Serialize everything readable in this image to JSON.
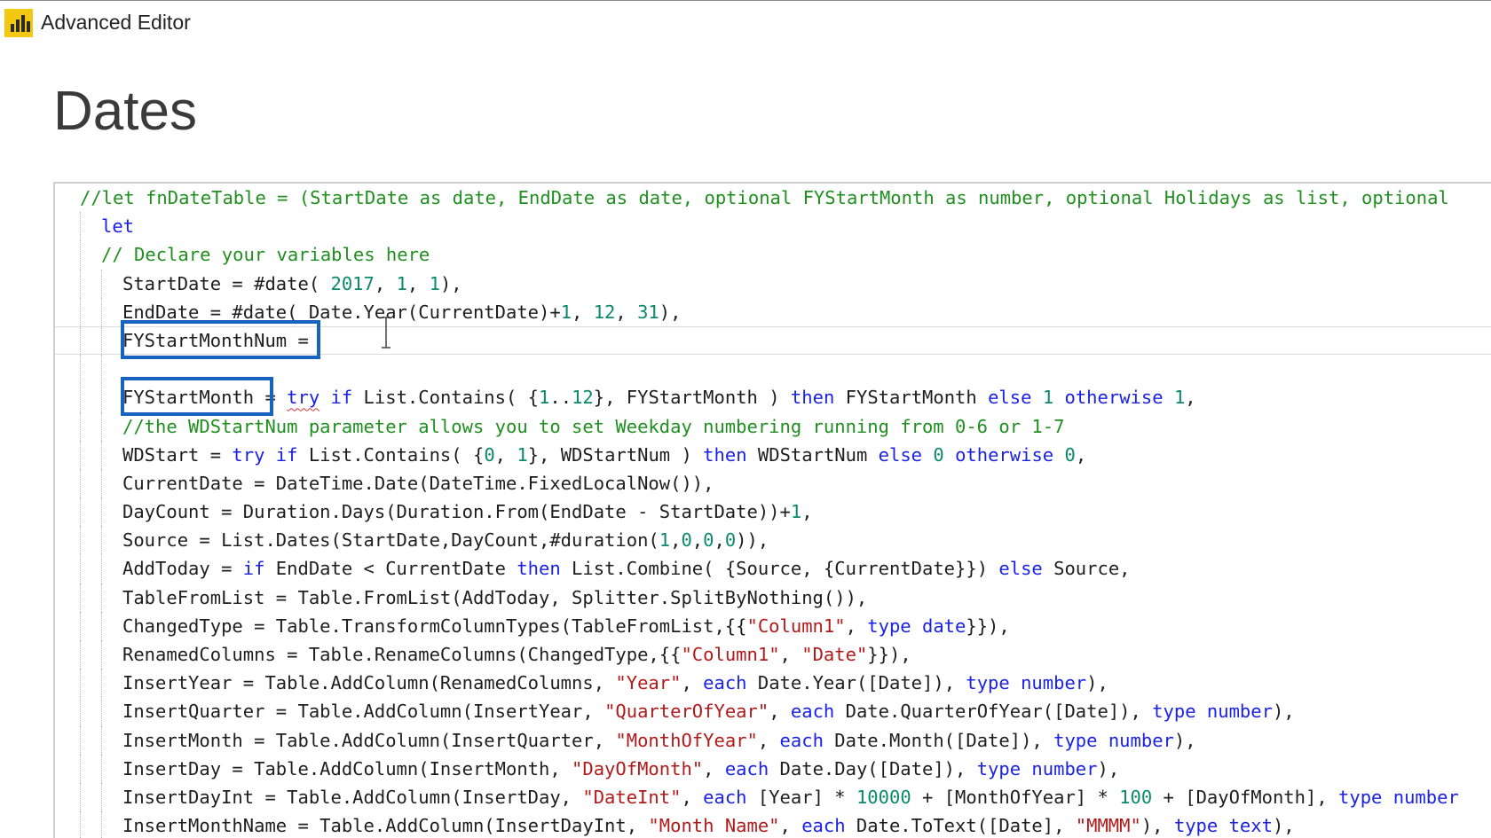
{
  "window": {
    "title": "Advanced Editor",
    "logo_icon": "power-bi-logo-icon",
    "accent_color": "#f2c811"
  },
  "query": {
    "name": "Dates"
  },
  "colors": {
    "comment": "#1f8f1f",
    "keyword": "#1a22e6",
    "string": "#b11a1a",
    "number": "#0a8a6a",
    "highlight": "#1565c0"
  },
  "editor": {
    "highlighted_tokens": [
      "FYStartMonthNum =",
      "FYStartMonth"
    ],
    "lines": [
      [
        [
          "cmt",
          "//let fnDateTable = (StartDate as date, EndDate as date, optional FYStartMonth as number, optional Holidays as list, optional"
        ]
      ],
      [
        [
          "kw",
          "let"
        ]
      ],
      [
        [
          "cmt",
          "// Declare your variables here"
        ]
      ],
      [
        [
          "",
          "StartDate = #date( "
        ],
        [
          "num",
          "2017"
        ],
        [
          "",
          ", "
        ],
        [
          "num",
          "1"
        ],
        [
          "",
          ", "
        ],
        [
          "num",
          "1"
        ],
        [
          "",
          "),"
        ]
      ],
      [
        [
          "",
          "EndDate = #date( Date.Year(CurrentDate)+"
        ],
        [
          "num",
          "1"
        ],
        [
          "",
          ", "
        ],
        [
          "num",
          "12"
        ],
        [
          "",
          ", "
        ],
        [
          "num",
          "31"
        ],
        [
          "",
          "),"
        ]
      ],
      [
        [
          "",
          "FYStartMonthNum ="
        ]
      ],
      [],
      [
        [
          "",
          "FYStartMonth = "
        ],
        [
          "kw squig",
          "try"
        ],
        [
          "",
          " "
        ],
        [
          "kw",
          "if"
        ],
        [
          "",
          " List.Contains( {"
        ],
        [
          "num",
          "1"
        ],
        [
          "",
          ".."
        ],
        [
          "num",
          "12"
        ],
        [
          "",
          "}, FYStartMonth ) "
        ],
        [
          "kw",
          "then"
        ],
        [
          "",
          " FYStartMonth "
        ],
        [
          "kw",
          "else"
        ],
        [
          "",
          " "
        ],
        [
          "num",
          "1"
        ],
        [
          "",
          " "
        ],
        [
          "kw",
          "otherwise"
        ],
        [
          "",
          " "
        ],
        [
          "num",
          "1"
        ],
        [
          "",
          ","
        ]
      ],
      [
        [
          "cmt",
          "//the WDStartNum parameter allows you to set Weekday numbering running from 0-6 or 1-7"
        ]
      ],
      [
        [
          "",
          "WDStart = "
        ],
        [
          "kw",
          "try"
        ],
        [
          "",
          " "
        ],
        [
          "kw",
          "if"
        ],
        [
          "",
          " List.Contains( {"
        ],
        [
          "num",
          "0"
        ],
        [
          "",
          ", "
        ],
        [
          "num",
          "1"
        ],
        [
          "",
          "}, WDStartNum ) "
        ],
        [
          "kw",
          "then"
        ],
        [
          "",
          " WDStartNum "
        ],
        [
          "kw",
          "else"
        ],
        [
          "",
          " "
        ],
        [
          "num",
          "0"
        ],
        [
          "",
          " "
        ],
        [
          "kw",
          "otherwise"
        ],
        [
          "",
          " "
        ],
        [
          "num",
          "0"
        ],
        [
          "",
          ","
        ]
      ],
      [
        [
          "",
          "CurrentDate = DateTime.Date(DateTime.FixedLocalNow()),"
        ]
      ],
      [
        [
          "",
          "DayCount = Duration.Days(Duration.From(EndDate - StartDate))+"
        ],
        [
          "num",
          "1"
        ],
        [
          "",
          ","
        ]
      ],
      [
        [
          "",
          "Source = List.Dates(StartDate,DayCount,#duration("
        ],
        [
          "num",
          "1"
        ],
        [
          "",
          ","
        ],
        [
          "num",
          "0"
        ],
        [
          "",
          ","
        ],
        [
          "num",
          "0"
        ],
        [
          "",
          ","
        ],
        [
          "num",
          "0"
        ],
        [
          "",
          ")),"
        ]
      ],
      [
        [
          "",
          "AddToday = "
        ],
        [
          "kw",
          "if"
        ],
        [
          "",
          " EndDate < CurrentDate "
        ],
        [
          "kw",
          "then"
        ],
        [
          "",
          " List.Combine( {Source, {CurrentDate}}) "
        ],
        [
          "kw",
          "else"
        ],
        [
          "",
          " Source,"
        ]
      ],
      [
        [
          "",
          "TableFromList = Table.FromList(AddToday, Splitter.SplitByNothing()),"
        ]
      ],
      [
        [
          "",
          "ChangedType = Table.TransformColumnTypes(TableFromList,{{"
        ],
        [
          "str",
          "\"Column1\""
        ],
        [
          "",
          ", "
        ],
        [
          "kw",
          "type"
        ],
        [
          "",
          " "
        ],
        [
          "kw",
          "date"
        ],
        [
          "",
          "}}),"
        ]
      ],
      [
        [
          "",
          "RenamedColumns = Table.RenameColumns(ChangedType,{{"
        ],
        [
          "str",
          "\"Column1\""
        ],
        [
          "",
          ", "
        ],
        [
          "str",
          "\"Date\""
        ],
        [
          "",
          "}}),"
        ]
      ],
      [
        [
          "",
          "InsertYear = Table.AddColumn(RenamedColumns, "
        ],
        [
          "str",
          "\"Year\""
        ],
        [
          "",
          ", "
        ],
        [
          "kw",
          "each"
        ],
        [
          "",
          " Date.Year([Date]), "
        ],
        [
          "kw",
          "type"
        ],
        [
          "",
          " "
        ],
        [
          "kw",
          "number"
        ],
        [
          "",
          "),"
        ]
      ],
      [
        [
          "",
          "InsertQuarter = Table.AddColumn(InsertYear, "
        ],
        [
          "str",
          "\"QuarterOfYear\""
        ],
        [
          "",
          ", "
        ],
        [
          "kw",
          "each"
        ],
        [
          "",
          " Date.QuarterOfYear([Date]), "
        ],
        [
          "kw",
          "type"
        ],
        [
          "",
          " "
        ],
        [
          "kw",
          "number"
        ],
        [
          "",
          "),"
        ]
      ],
      [
        [
          "",
          "InsertMonth = Table.AddColumn(InsertQuarter, "
        ],
        [
          "str",
          "\"MonthOfYear\""
        ],
        [
          "",
          ", "
        ],
        [
          "kw",
          "each"
        ],
        [
          "",
          " Date.Month([Date]), "
        ],
        [
          "kw",
          "type"
        ],
        [
          "",
          " "
        ],
        [
          "kw",
          "number"
        ],
        [
          "",
          "),"
        ]
      ],
      [
        [
          "",
          "InsertDay = Table.AddColumn(InsertMonth, "
        ],
        [
          "str",
          "\"DayOfMonth\""
        ],
        [
          "",
          ", "
        ],
        [
          "kw",
          "each"
        ],
        [
          "",
          " Date.Day([Date]), "
        ],
        [
          "kw",
          "type"
        ],
        [
          "",
          " "
        ],
        [
          "kw",
          "number"
        ],
        [
          "",
          "),"
        ]
      ],
      [
        [
          "",
          "InsertDayInt = Table.AddColumn(InsertDay, "
        ],
        [
          "str",
          "\"DateInt\""
        ],
        [
          "",
          ", "
        ],
        [
          "kw",
          "each"
        ],
        [
          "",
          " [Year] * "
        ],
        [
          "num",
          "10000"
        ],
        [
          "",
          " + [MonthOfYear] * "
        ],
        [
          "num",
          "100"
        ],
        [
          "",
          " + [DayOfMonth], "
        ],
        [
          "kw",
          "type"
        ],
        [
          "",
          " "
        ],
        [
          "kw",
          "number"
        ]
      ],
      [
        [
          "",
          "InsertMonthName = Table.AddColumn(InsertDayInt, "
        ],
        [
          "str",
          "\"Month Name\""
        ],
        [
          "",
          ", "
        ],
        [
          "kw",
          "each"
        ],
        [
          "",
          " Date.ToText([Date], "
        ],
        [
          "str",
          "\"MMMM\""
        ],
        [
          "",
          "), "
        ],
        [
          "kw",
          "type"
        ],
        [
          "",
          " "
        ],
        [
          "kw",
          "text"
        ],
        [
          "",
          "),"
        ]
      ]
    ]
  }
}
